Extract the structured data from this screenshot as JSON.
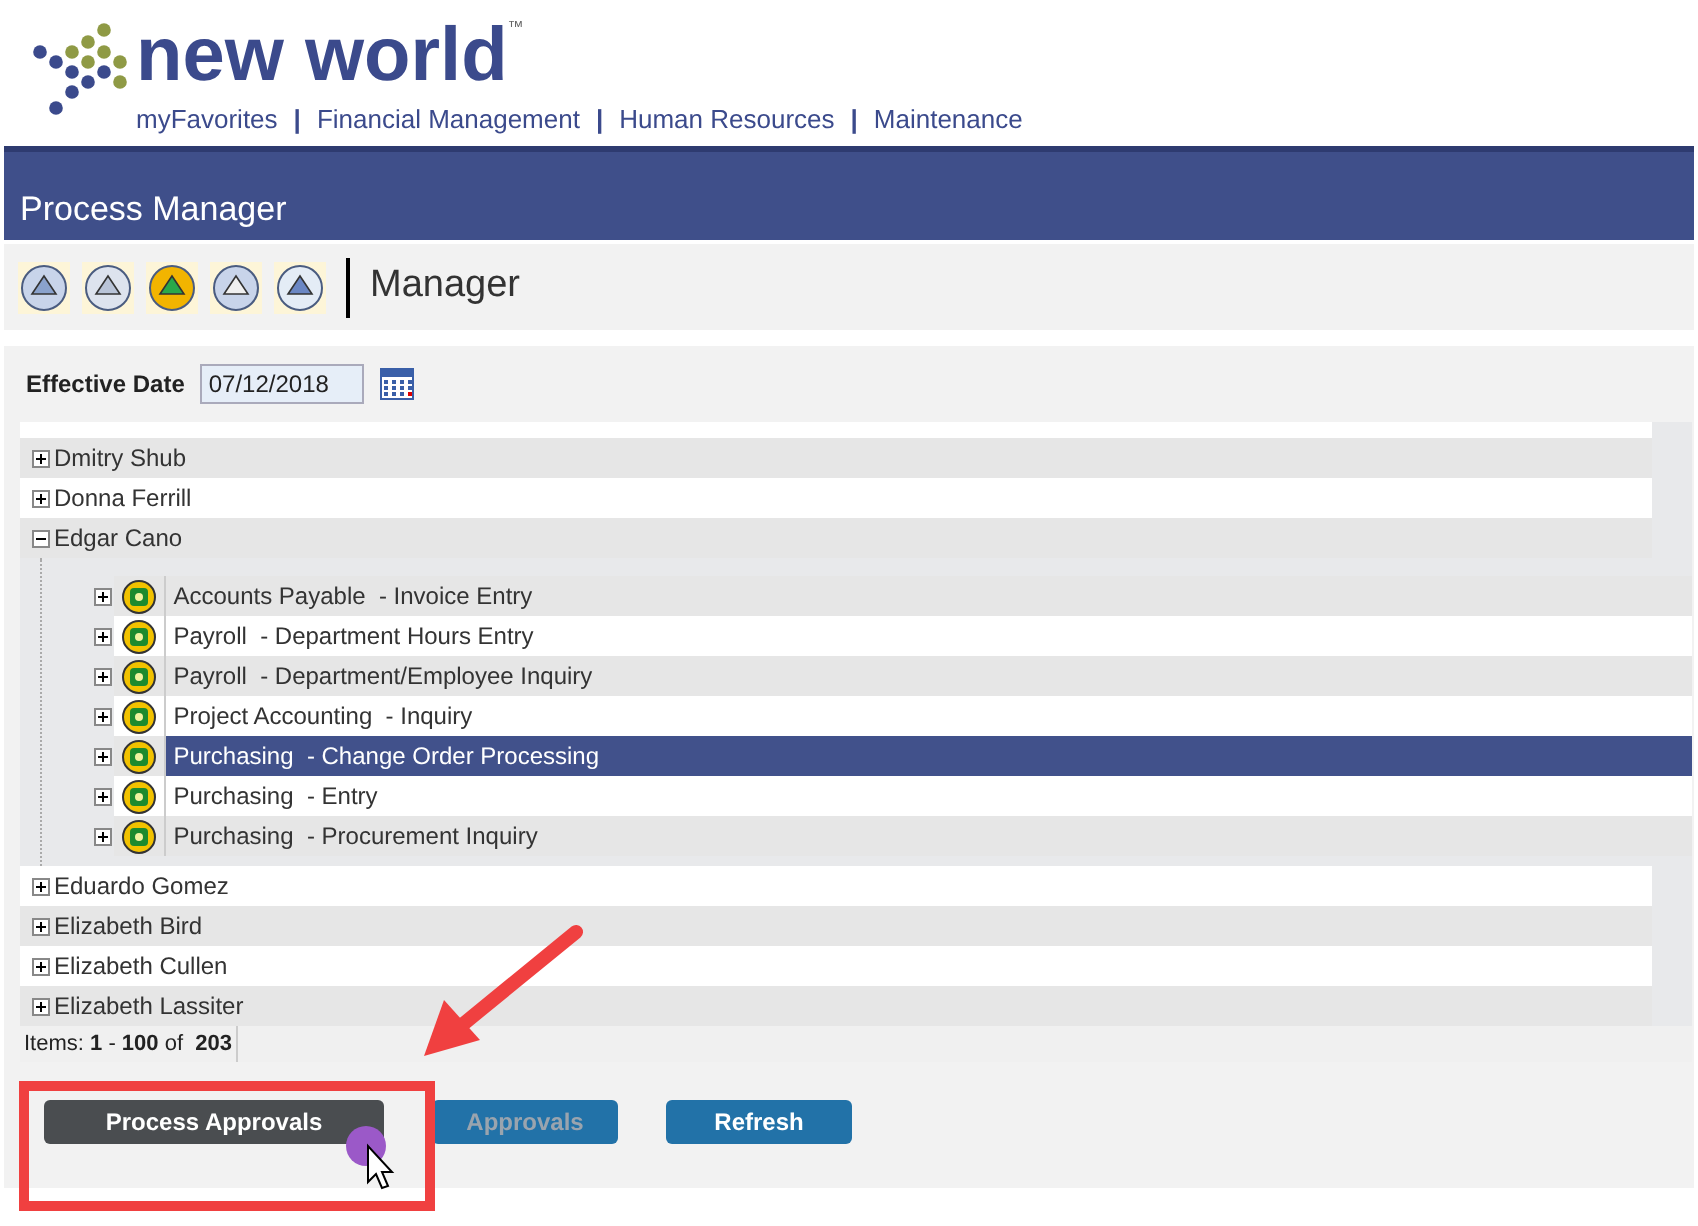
{
  "brand": {
    "name": "new world",
    "trademark": "™"
  },
  "nav": {
    "separator": "|",
    "items": [
      "myFavorites",
      "Financial Management",
      "Human Resources",
      "Maintenance"
    ]
  },
  "title_bar": {
    "title": "Process Manager"
  },
  "toolbar": {
    "label": "Manager"
  },
  "effective_date": {
    "label": "Effective Date",
    "value": "07/12/2018"
  },
  "tree": {
    "employees": [
      {
        "name": "Dmitry Shub",
        "expanded": false
      },
      {
        "name": "Donna Ferrill",
        "expanded": false
      },
      {
        "name": "Edgar Cano",
        "expanded": true,
        "children": [
          {
            "label": "Accounts Payable  - Invoice Entry",
            "expanded": false,
            "selected": false
          },
          {
            "label": "Payroll  - Department Hours Entry",
            "expanded": false,
            "selected": false
          },
          {
            "label": "Payroll  - Department/Employee Inquiry",
            "expanded": false,
            "selected": false
          },
          {
            "label": "Project Accounting  - Inquiry",
            "expanded": false,
            "selected": false
          },
          {
            "label": "Purchasing  - Change Order Processing",
            "expanded": false,
            "selected": true
          },
          {
            "label": "Purchasing  - Entry",
            "expanded": false,
            "selected": false
          },
          {
            "label": "Purchasing  - Procurement Inquiry",
            "expanded": false,
            "selected": false
          }
        ]
      },
      {
        "name": "Eduardo Gomez",
        "expanded": false
      },
      {
        "name": "Elizabeth Bird",
        "expanded": false
      },
      {
        "name": "Elizabeth Cullen",
        "expanded": false
      },
      {
        "name": "Elizabeth Lassiter",
        "expanded": false
      }
    ]
  },
  "pager": {
    "text": "Items: **1** - **100** of  **203**"
  },
  "buttons": [
    {
      "label": "Process Approvals",
      "hovered": true,
      "disabled": false
    },
    {
      "label": "Approvals",
      "hovered": false,
      "disabled": true
    },
    {
      "label": "Refresh",
      "hovered": false,
      "disabled": false
    }
  ]
}
